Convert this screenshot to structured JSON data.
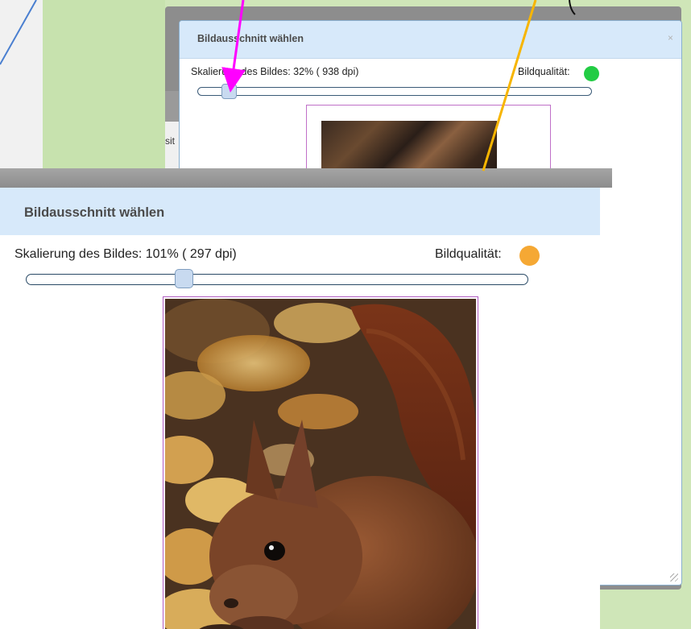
{
  "back_dialog": {
    "title": "Bildausschnitt wählen",
    "close_glyph": "×",
    "scale_label": "Skalierung des Bildes: 32% ( 938 dpi)",
    "quality_label": "Bildqualität:",
    "quality_color": "#22cc44",
    "slider_value_percent": 32,
    "partial_text": "sit"
  },
  "front_dialog": {
    "title": "Bildausschnitt wählen",
    "scale_label": "Skalierung des Bildes: 101% ( 297 dpi)",
    "quality_label": "Bildqualität:",
    "quality_color": "#f5a834",
    "slider_value_percent": 101
  },
  "annotations": {
    "arrow_colors": [
      "#4a7fd0",
      "#ff00ff",
      "#f7b500"
    ]
  },
  "icons": {
    "close": "close-icon",
    "resize": "resize-grip-icon",
    "quality_indicator": "status-dot-icon"
  }
}
